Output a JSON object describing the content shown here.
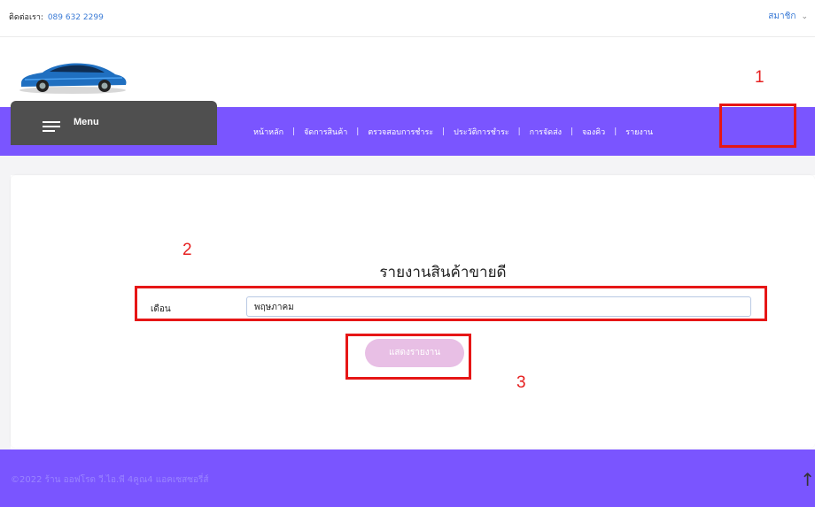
{
  "topbar": {
    "contact_label": "ติดต่อเรา:",
    "contact_phone": "089 632 2299",
    "member_label": "สมาชิก",
    "member_chevron": "⌄"
  },
  "menu": {
    "label": "Menu"
  },
  "nav": {
    "items": [
      "หน้าหลัก",
      "จัดการสินค้า",
      "ตรวจสอบการชำระ",
      "ประวัติการชำระ",
      "การจัดส่ง",
      "จองคิว",
      "รายงาน"
    ],
    "separator": "|"
  },
  "annotations": {
    "marker1": "1",
    "marker2": "2",
    "marker3": "3"
  },
  "report": {
    "title": "รายงานสินค้าขายดี",
    "month_label": "เดือน",
    "month_value": "พฤษภาคม",
    "show_button": "แสดงรายงาน"
  },
  "footer": {
    "copyright": "©2022 ร้าน ออฟโรด วี.ไอ.พี 4คูณ4 แอคเซสซอรี่ส์",
    "up_arrow": "↑"
  },
  "colors": {
    "nav_bg": "#7a55ff",
    "menu_bg": "#4f4f4f",
    "highlight_red": "#e61616",
    "button_bg": "#e8bfe5",
    "link_blue": "#3b7bd6"
  }
}
